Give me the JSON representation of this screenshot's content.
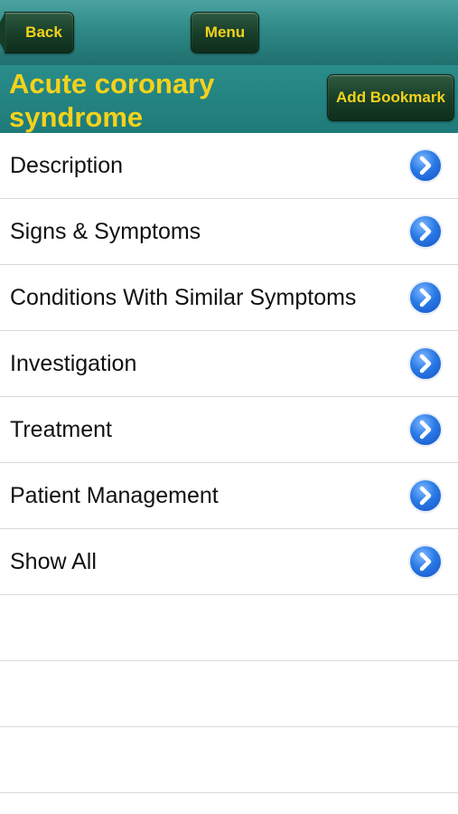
{
  "nav": {
    "back_label": "Back",
    "menu_label": "Menu"
  },
  "title_bar": {
    "title": "Acute coronary syndrome",
    "bookmark_label": "Add Bookmark"
  },
  "list": {
    "items": [
      {
        "label": "Description"
      },
      {
        "label": "Signs & Symptoms"
      },
      {
        "label": "Conditions With Similar Symptoms"
      },
      {
        "label": "Investigation"
      },
      {
        "label": "Treatment"
      },
      {
        "label": "Patient Management"
      },
      {
        "label": "Show All"
      }
    ]
  },
  "icons": {
    "disclosure": "chevron-right-circle-icon",
    "back": "back-arrow-icon"
  },
  "colors": {
    "navbar": "#2f8a88",
    "button_bg": "#173d27",
    "button_text": "#f4d21c",
    "title_text": "#f4d21c",
    "disclosure_blue": "#2a7ae6"
  }
}
